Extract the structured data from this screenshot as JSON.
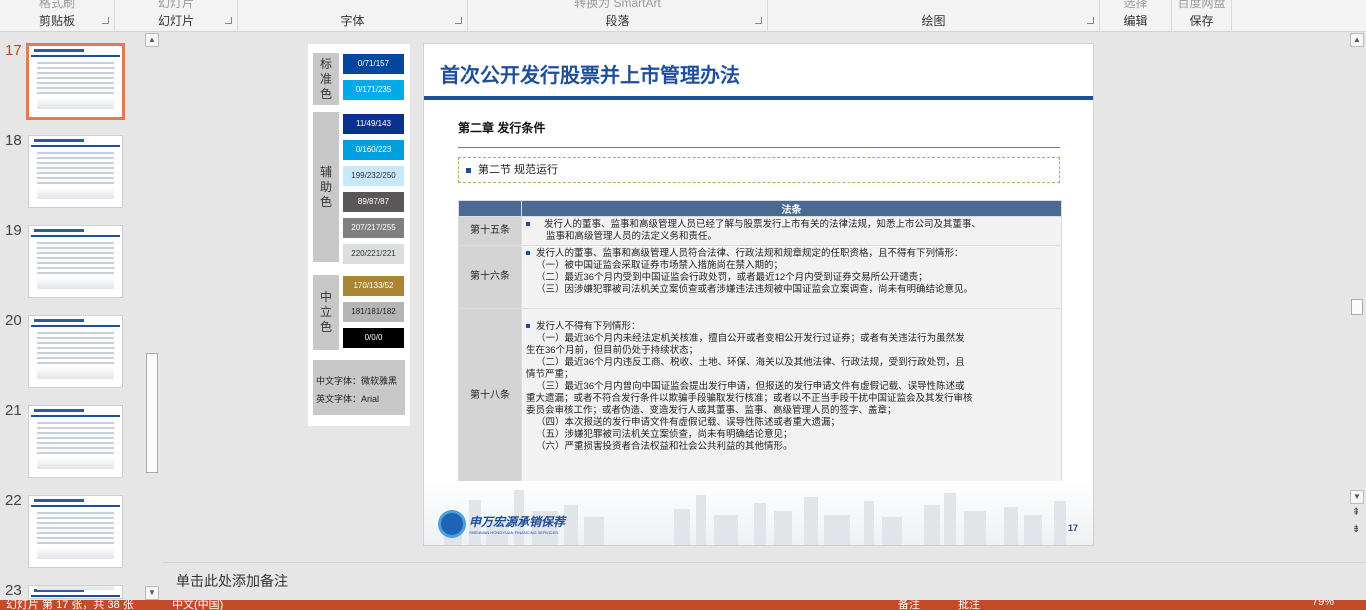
{
  "ribbon": {
    "groups": [
      {
        "top": "格式刷",
        "label": "剪贴板"
      },
      {
        "top": "幻灯片",
        "label": "幻灯片"
      },
      {
        "top": "",
        "label": "字体"
      },
      {
        "top": "转换为 SmartArt",
        "label": "段落"
      },
      {
        "top": "",
        "label": "绘图"
      },
      {
        "top": "选择",
        "label": "编辑"
      },
      {
        "top": "百度网盘",
        "label": "保存"
      }
    ]
  },
  "thumbnails": [
    {
      "num": "17"
    },
    {
      "num": "18"
    },
    {
      "num": "19"
    },
    {
      "num": "20"
    },
    {
      "num": "21"
    },
    {
      "num": "22"
    },
    {
      "num": "23"
    }
  ],
  "palette": {
    "categories": [
      "标准色",
      "辅助色",
      "中立色"
    ],
    "swatches": [
      {
        "label": "0/71/157",
        "color": "#00479d",
        "text": "#ffffff"
      },
      {
        "label": "0/171/235",
        "color": "#00abeb",
        "text": "#ffffff"
      },
      {
        "label": "11/49/143",
        "color": "#0b318f",
        "text": "#ffffff"
      },
      {
        "label": "0/160/223",
        "color": "#00a0df",
        "text": "#ffffff"
      },
      {
        "label": "199/232/250",
        "color": "#c7e8fa",
        "text": "#333333"
      },
      {
        "label": "89/87/87",
        "color": "#595757",
        "text": "#ffffff"
      },
      {
        "label": "207/217/255",
        "color": "#7f7f7f",
        "text": "#ffffff"
      },
      {
        "label": "220/221/221",
        "color": "#dcdddd",
        "text": "#333333"
      },
      {
        "label": "170/133/52",
        "color": "#aa8534",
        "text": "#ffffff"
      },
      {
        "label": "181/181/182",
        "color": "#b5b5b6",
        "text": "#222222"
      },
      {
        "label": "0/0/0",
        "color": "#000000",
        "text": "#ffffff"
      }
    ],
    "font_cn": "中文字体：微软雅黑",
    "font_en": "英文字体：Arial"
  },
  "slide": {
    "title": "首次公开发行股票并上市管理办法",
    "chapter": "第二章 发行条件",
    "section": "第二节 规范运行",
    "table_header": "法条",
    "rows": [
      {
        "article": "第十五条",
        "lines": [
          "发行人的董事、监事和高级管理人员已经了解与股票发行上市有关的法律法规，知悉上市公司及其董事、",
          "监事和高级管理人员的法定义务和责任。"
        ]
      },
      {
        "article": "第十六条",
        "lines": [
          "发行人的董事、监事和高级管理人员符合法律、行政法规和规章规定的任职资格，且不得有下列情形：",
          "（一）被中国证监会采取证券市场禁入措施尚在禁入期的；",
          "（二）最近36个月内受到中国证监会行政处罚，或者最近12个月内受到证券交易所公开谴责；",
          "（三）因涉嫌犯罪被司法机关立案侦查或者涉嫌违法违规被中国证监会立案调查，尚未有明确结论意见。"
        ]
      },
      {
        "article": "第十八条",
        "lines": [
          "发行人不得有下列情形：",
          "（一）最近36个月内未经法定机关核准，擅自公开或者变相公开发行过证券；或者有关违法行为虽然发",
          "生在36个月前，但目前仍处于持续状态；",
          "（二）最近36个月内违反工商、税收、土地、环保、海关以及其他法律、行政法规，受到行政处罚，且",
          "情节严重；",
          "（三）最近36个月内曾向中国证监会提出发行申请，但报送的发行申请文件有虚假记载、误导性陈述或",
          "重大遗漏；或者不符合发行条件以欺骗手段骗取发行核准；或者以不正当手段干扰中国证监会及其发行审核",
          "委员会审核工作；或者伪造、变造发行人或其董事、监事、高级管理人员的签字、盖章；",
          "（四）本次报送的发行申请文件有虚假记载、误导性陈述或者重大遗漏；",
          "（五）涉嫌犯罪被司法机关立案侦查，尚未有明确结论意见；",
          "（六）严重损害投资者合法权益和社会公共利益的其他情形。"
        ]
      }
    ],
    "logo_text": "申万宏源承销保荐",
    "logo_sub": "SHENWAN HONGYUAN FINANCING SERVICES",
    "page_number": "17"
  },
  "notes_placeholder": "单击此处添加备注",
  "status": {
    "slide_info": "幻灯片 第 17 张，共 38 张",
    "language": "中文(中国)",
    "notes": "备注",
    "comments": "批注",
    "zoom": "79%"
  }
}
